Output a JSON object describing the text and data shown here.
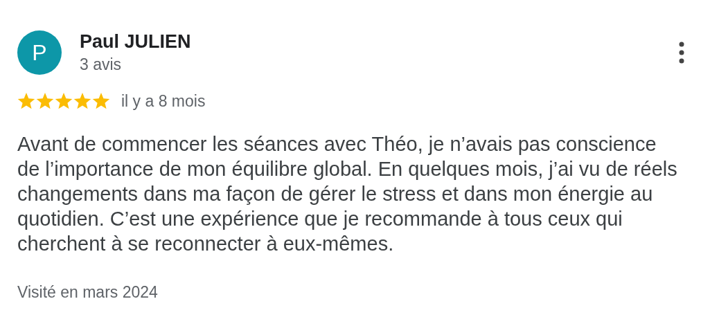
{
  "review": {
    "avatar_letter": "P",
    "author": "Paul JULIEN",
    "review_count": "3 avis",
    "stars": 5,
    "time": "il y a 8 mois",
    "text": "Avant de commencer les séances avec Théo, je n’avais pas conscience de l’importance de mon équilibre global. En quelques mois, j’ai vu de réels changements dans ma façon de gérer le stress et dans mon énergie au quotidien. C’est une expérience que je recommande à tous ceux qui cherchent à se reconnecter à eux-mêmes.",
    "visited": "Visité en mars 2024"
  }
}
